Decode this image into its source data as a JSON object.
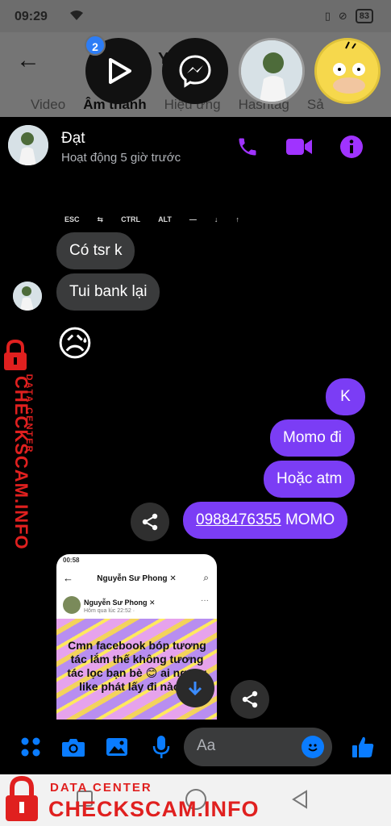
{
  "status_bar": {
    "time": "09:29",
    "battery": "83"
  },
  "background_app": {
    "title": "Y... h",
    "tabs": [
      "Video",
      "Âm thanh",
      "Hiệu ứng",
      "Hashtag",
      "Sả"
    ],
    "active_tab": "Âm thanh"
  },
  "chat_heads": {
    "badge_count": "2"
  },
  "chat": {
    "contact_name": "Đạt",
    "contact_status": "Hoạt động 5 giờ trước",
    "keyboard_keys": [
      "ESC",
      "⇆",
      "CTRL",
      "ALT",
      "—",
      "↓",
      "↑"
    ],
    "incoming": [
      {
        "text": "Có tsr k"
      },
      {
        "text": "Tui bank lại"
      },
      {
        "text": "😥"
      }
    ],
    "outgoing": [
      {
        "text": "K"
      },
      {
        "text": "Momo đi"
      },
      {
        "text": "Hoặc atm"
      }
    ],
    "phone_message": {
      "number": "0988476355",
      "suffix": " MOMO"
    },
    "shared_screenshot": {
      "status_time": "00:58",
      "page_title": "Nguyễn Sư Phong ✕",
      "poster_name": "Nguyễn Sư Phong ✕",
      "post_time": "Hôm qua lúc 22:52 · ",
      "post_text": "Cmn facebook bóp tương tác lắm thế không tương tác lọc bạn bè 😊 ai ngang like phát lấy đi nào 😚"
    },
    "composer_placeholder": "Aa"
  },
  "watermark": {
    "small": "DATA CENTER",
    "big": "CHECKSCAM.INFO"
  },
  "colors": {
    "accent": "#7b3df5",
    "messenger_blue": "#0a7cff",
    "header_icons": "#a033ff",
    "watermark": "#e0201f"
  }
}
